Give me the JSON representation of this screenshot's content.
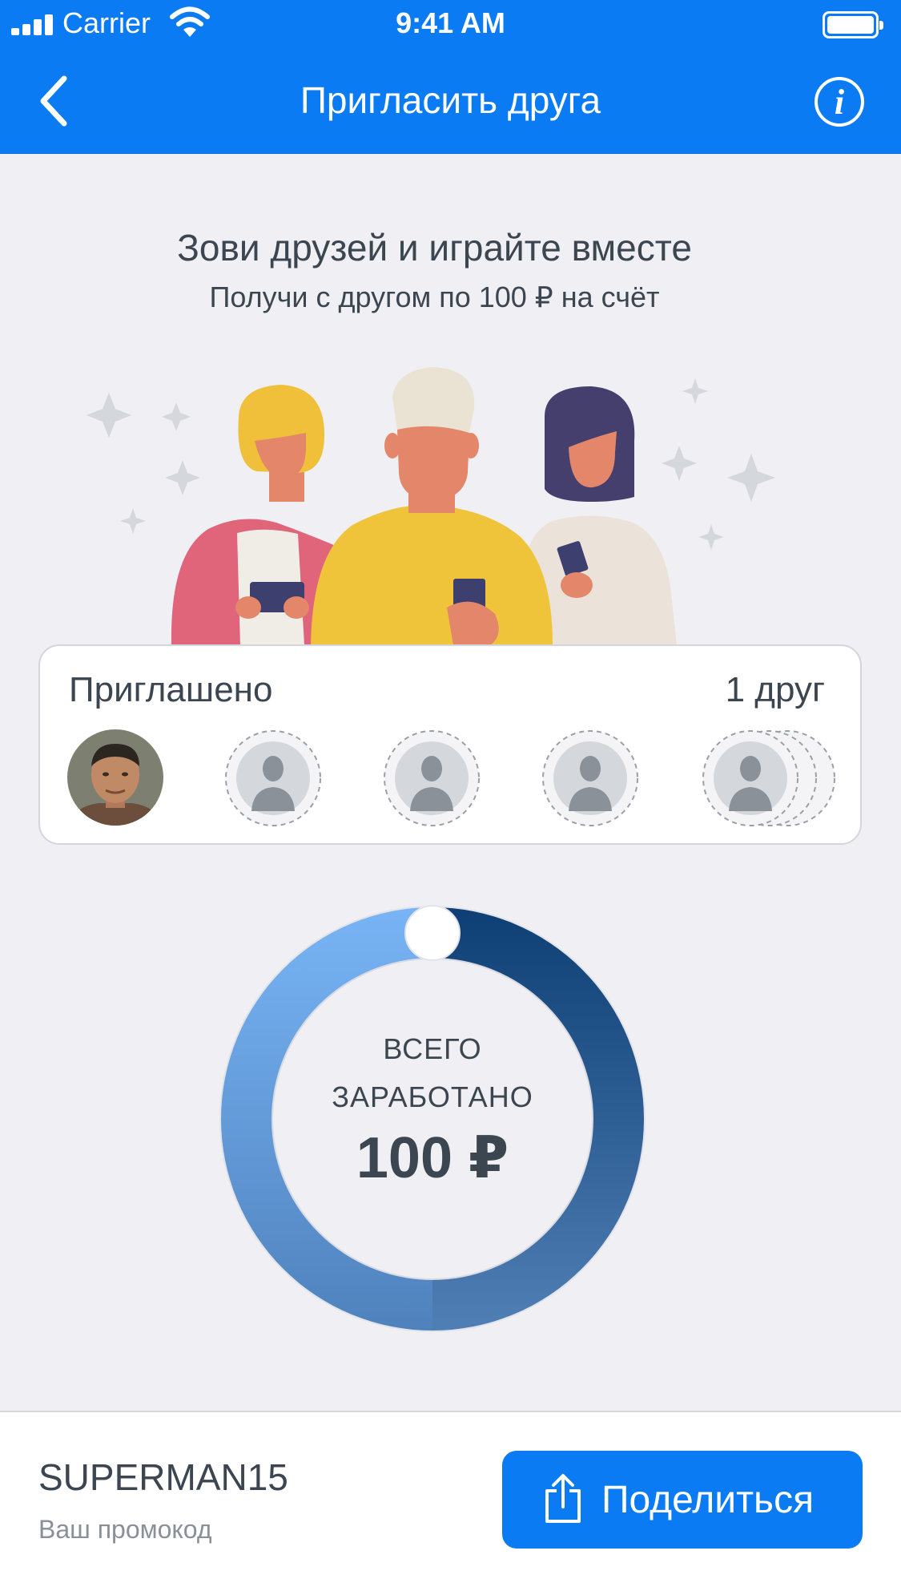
{
  "status_bar": {
    "carrier": "Carrier",
    "time": "9:41 AM"
  },
  "nav": {
    "title": "Пригласить друга",
    "info_glyph": "i",
    "back_icon": "chevron-left-icon"
  },
  "intro": {
    "headline": "Зови друзей и играйте вместе",
    "subline": "Получи с другом по 100 ₽ на счёт"
  },
  "invited": {
    "label": "Приглашено",
    "count": "1 друг",
    "invited_friends": 1,
    "empty_slots": 4
  },
  "earnings": {
    "title_line1": "ВСЕГО",
    "title_line2": "ЗАРАБОТАНО",
    "value": "100 ₽"
  },
  "footer": {
    "promo_code": "SUPERMAN15",
    "promo_label": "Ваш промокод",
    "share_label": "Поделиться",
    "share_icon": "share-icon"
  },
  "colors": {
    "accent": "#0a7bf3",
    "background": "#efeff4",
    "text": "#3c4650",
    "ring_light": "#78b4f5",
    "ring_dark": "#0e3f74"
  }
}
